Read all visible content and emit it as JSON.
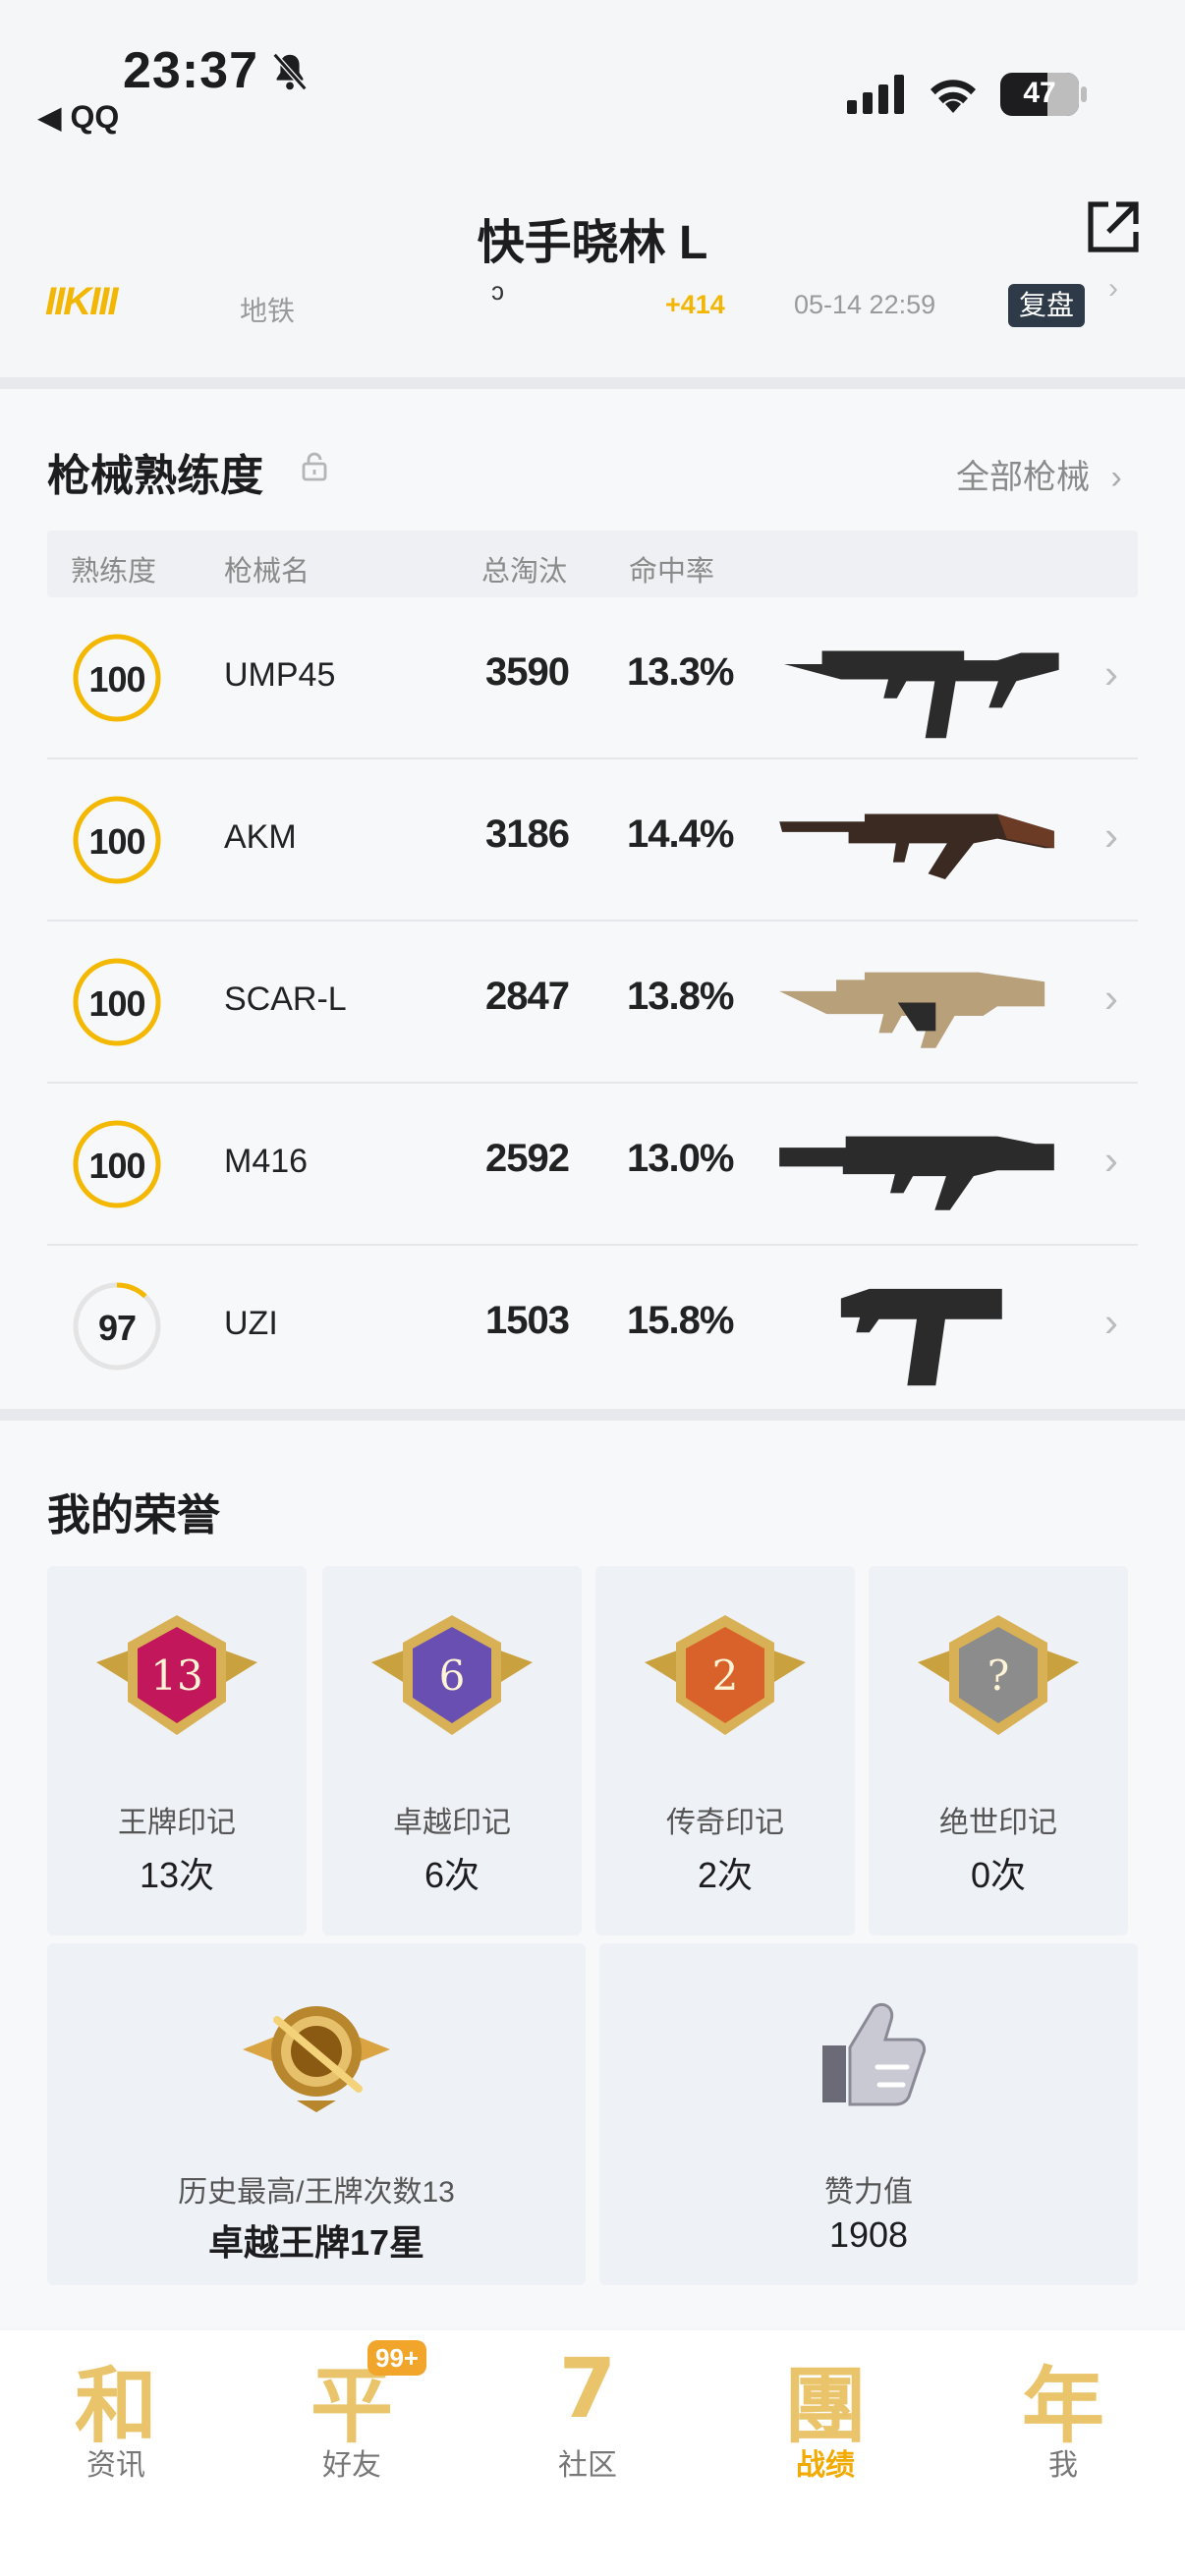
{
  "status_bar": {
    "time": "23:37",
    "back_app": "◀ QQ",
    "battery": "47",
    "battery_level": 0.47
  },
  "header": {
    "title": "快手晓林 L",
    "prev_match": {
      "mode": "地铁",
      "score": "+414",
      "date": "05-14 22:59",
      "review": "复盘"
    }
  },
  "weapons": {
    "title": "枪械熟练度",
    "all_link": "全部枪械",
    "columns": [
      "熟练度",
      "枪械名",
      "总淘汰",
      "命中率"
    ],
    "rows": [
      {
        "level": "100",
        "progress": 1.0,
        "name": "UMP45",
        "kills": "3590",
        "rate": "13.3%"
      },
      {
        "level": "100",
        "progress": 1.0,
        "name": "AKM",
        "kills": "3186",
        "rate": "14.4%"
      },
      {
        "level": "100",
        "progress": 1.0,
        "name": "SCAR-L",
        "kills": "2847",
        "rate": "13.8%"
      },
      {
        "level": "100",
        "progress": 1.0,
        "name": "M416",
        "kills": "2592",
        "rate": "13.0%"
      },
      {
        "level": "97",
        "progress": 0.12,
        "name": "UZI",
        "kills": "1503",
        "rate": "15.8%"
      }
    ]
  },
  "honors": {
    "title": "我的荣誉",
    "marks": [
      {
        "badge_text": "13",
        "label": "王牌印记",
        "value": "13次",
        "color": "#c2185b"
      },
      {
        "badge_text": "6",
        "label": "卓越印记",
        "value": "6次",
        "color": "#6a4fb3"
      },
      {
        "badge_text": "2",
        "label": "传奇印记",
        "value": "2次",
        "color": "#d9622b"
      },
      {
        "badge_text": "?",
        "label": "绝世印记",
        "value": "0次",
        "color": "#8c8c8c"
      }
    ],
    "highest": {
      "label": "历史最高/王牌次数13",
      "value": "卓越王牌17星"
    },
    "likes": {
      "label": "赞力值",
      "value": "1908"
    }
  },
  "tabbar": {
    "badge": "99+",
    "tabs": [
      {
        "glyph": "和",
        "label": "资讯"
      },
      {
        "glyph": "平",
        "label": "好友"
      },
      {
        "glyph": "7",
        "label": "社区"
      },
      {
        "glyph": "團",
        "label": "战绩"
      },
      {
        "glyph": "年",
        "label": "我"
      }
    ]
  },
  "colors": {
    "accent": "#f2b705",
    "ring": "#f5b800",
    "active_tab": "#f2a900"
  }
}
